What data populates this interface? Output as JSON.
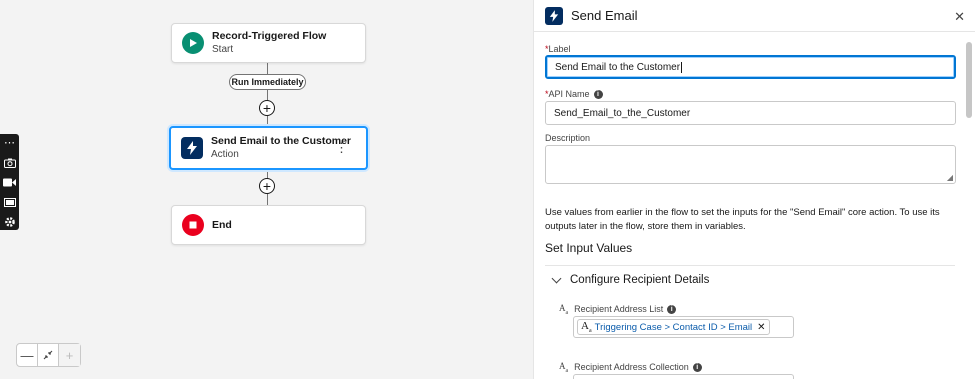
{
  "canvas": {
    "nodes": {
      "start": {
        "title": "Record-Triggered Flow",
        "subtitle": "Start",
        "icon": "play-icon"
      },
      "action": {
        "title": "Send Email to the Customer",
        "subtitle": "Action",
        "icon": "lightning-icon"
      },
      "end": {
        "title": "End",
        "icon": "stop-icon"
      }
    },
    "path_label": "Run Immediately",
    "zoom_controls": [
      "zoom-out",
      "fit-to-view",
      "zoom-in"
    ]
  },
  "panel": {
    "title": "Send Email",
    "label_field": {
      "label": "Label",
      "value": "Send Email to the Customer"
    },
    "api_name_field": {
      "label": "API Name",
      "value": "Send_Email_to_the_Customer"
    },
    "description_field": {
      "label": "Description",
      "value": ""
    },
    "help_text": "Use values from earlier in the flow to set the inputs for the \"Send Email\" core action. To use its outputs later in the flow, store them in variables.",
    "set_input_values": "Set Input Values",
    "configure_section": "Configure Recipient Details",
    "recipient_address_list": {
      "label": "Recipient Address List",
      "token": "Triggering Case > Contact ID > Email"
    },
    "recipient_address_collection": {
      "label": "Recipient Address Collection"
    }
  },
  "colors": {
    "accent": "#0176d3",
    "start": "#088f72",
    "action": "#032d60",
    "end": "#ea001e"
  }
}
